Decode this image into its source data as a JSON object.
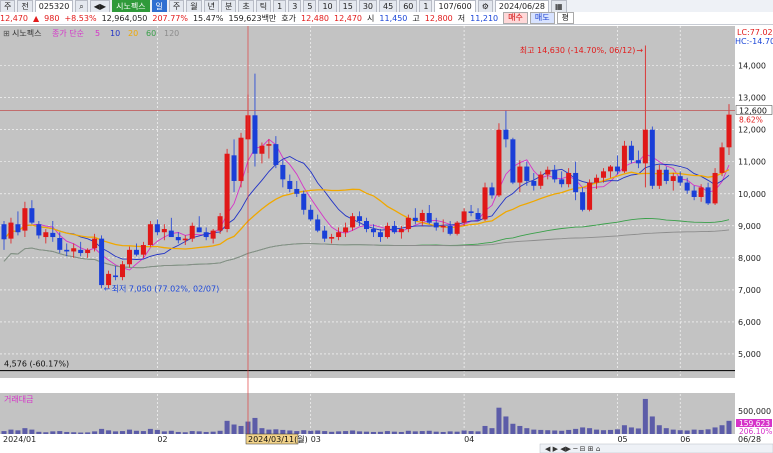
{
  "toolbar": {
    "period_select": "주",
    "type_select": "전",
    "code": "025320",
    "name": "시노펙스",
    "period_buttons": [
      "일",
      "주",
      "월",
      "년",
      "분",
      "초",
      "틱"
    ],
    "interval_buttons": [
      "1",
      "3",
      "5",
      "10",
      "15",
      "30",
      "45",
      "60",
      "1"
    ],
    "range": "107/600",
    "date": "2024/06/28"
  },
  "quote": {
    "price": "12,470",
    "change": "980",
    "change_pct": "+8.53%",
    "volume": "12,964,050",
    "volume_ratio": "207.77%",
    "turnover": "15.47%",
    "value": "159,623백만",
    "ask_label": "호가",
    "ask": "12,480",
    "bid": "12,470",
    "open_label": "시",
    "open": "11,450",
    "high_label": "고",
    "high": "12,800",
    "low_label": "저",
    "low": "11,210",
    "buy_label": "매수",
    "sell_label": "매도",
    "eval_label": "평"
  },
  "legend": {
    "name": "시노펙스",
    "ma_label": "종가 단순",
    "ma_periods": [
      "5",
      "10",
      "20",
      "60",
      "120"
    ],
    "ma_colors": [
      "#d633c9",
      "#2233c6",
      "#f0a800",
      "#3aa04a",
      "#8c8c8c"
    ]
  },
  "annotations": {
    "lc": "LC:77.02",
    "hc": "HC:-14.70",
    "high": "최고 14,630 (-14.70%, 06/12)",
    "low": "최저 7,050 (77.02%, 02/07)",
    "baseline": "4,576 (-60.17%)",
    "crosshair_date": "2024/03/11(월)",
    "current_price": "12,600",
    "current_pct": "8.62%",
    "current_vol": "159,623",
    "current_vol_pct": "206.10%",
    "volume_title": "거래대금"
  },
  "chart_data": {
    "type": "candlestick",
    "price_axis": {
      "ticks": [
        5000,
        6000,
        7000,
        8000,
        9000,
        10000,
        11000,
        12000,
        13000,
        14000
      ]
    },
    "volume_axis": {
      "tick_label": "500,000",
      "tick": 500000
    },
    "x_labels": [
      "2024/01",
      "02",
      "03",
      "04",
      "05",
      "06",
      "06/28"
    ],
    "candles": [
      [
        9050,
        9150,
        8250,
        8580
      ],
      [
        8600,
        9250,
        8450,
        9100
      ],
      [
        9050,
        9450,
        8700,
        8800
      ],
      [
        8850,
        9750,
        8650,
        9550
      ],
      [
        9550,
        9800,
        9050,
        9100
      ],
      [
        9050,
        9150,
        8600,
        8700
      ],
      [
        8650,
        8900,
        8450,
        8800
      ],
      [
        8780,
        9150,
        8500,
        8650
      ],
      [
        8620,
        8800,
        8150,
        8250
      ],
      [
        8250,
        8450,
        8050,
        8200
      ],
      [
        8200,
        8450,
        8000,
        8300
      ],
      [
        8250,
        8500,
        8050,
        8150
      ],
      [
        8150,
        8300,
        8000,
        8250
      ],
      [
        8300,
        8750,
        8200,
        8600
      ],
      [
        8600,
        8700,
        7050,
        7150
      ],
      [
        7150,
        7600,
        7050,
        7500
      ],
      [
        7450,
        7750,
        7300,
        7400
      ],
      [
        7400,
        7900,
        7300,
        7800
      ],
      [
        7800,
        8350,
        7700,
        8250
      ],
      [
        8250,
        8450,
        8050,
        8100
      ],
      [
        8100,
        8500,
        8000,
        8400
      ],
      [
        8400,
        9150,
        8350,
        9050
      ],
      [
        9050,
        9200,
        8700,
        8800
      ],
      [
        8800,
        9050,
        8550,
        8900
      ],
      [
        8850,
        9250,
        8750,
        8650
      ],
      [
        8650,
        8800,
        8450,
        8550
      ],
      [
        8550,
        8700,
        8400,
        8600
      ],
      [
        8600,
        9100,
        8500,
        9000
      ],
      [
        8950,
        9300,
        8800,
        8800
      ],
      [
        8800,
        8950,
        8550,
        8650
      ],
      [
        8600,
        8900,
        8450,
        8850
      ],
      [
        8850,
        9400,
        8750,
        9300
      ],
      [
        8900,
        11400,
        8800,
        11250
      ],
      [
        11200,
        11700,
        10050,
        10400
      ],
      [
        10400,
        11900,
        10200,
        11750
      ],
      [
        11700,
        13100,
        10650,
        12450
      ],
      [
        12450,
        13750,
        10850,
        11250
      ],
      [
        11250,
        11600,
        10950,
        11500
      ],
      [
        11500,
        11700,
        11100,
        11550
      ],
      [
        11550,
        11800,
        10800,
        10900
      ],
      [
        10900,
        11050,
        10200,
        10450
      ],
      [
        10400,
        10600,
        10050,
        10150
      ],
      [
        10150,
        10400,
        9900,
        10000
      ],
      [
        10000,
        10100,
        9350,
        9500
      ],
      [
        9500,
        9650,
        9150,
        9200
      ],
      [
        9200,
        9350,
        8800,
        8850
      ],
      [
        8850,
        9000,
        8500,
        8600
      ],
      [
        8600,
        8750,
        8450,
        8650
      ],
      [
        8650,
        8950,
        8550,
        8800
      ],
      [
        8800,
        9100,
        8650,
        8950
      ],
      [
        8950,
        9400,
        8850,
        9300
      ],
      [
        9300,
        9450,
        9000,
        9150
      ],
      [
        9150,
        9250,
        8800,
        8900
      ],
      [
        8900,
        9050,
        8650,
        8800
      ],
      [
        8800,
        8900,
        8500,
        8650
      ],
      [
        8650,
        9100,
        8600,
        9000
      ],
      [
        9000,
        9150,
        8750,
        8800
      ],
      [
        8800,
        9000,
        8600,
        8900
      ],
      [
        8900,
        9350,
        8800,
        9250
      ],
      [
        9250,
        9550,
        9050,
        9150
      ],
      [
        9150,
        9500,
        9000,
        9400
      ],
      [
        9400,
        9650,
        9050,
        9100
      ],
      [
        9100,
        9250,
        8850,
        8950
      ],
      [
        8950,
        9200,
        8800,
        9000
      ],
      [
        9000,
        9150,
        8700,
        8750
      ],
      [
        8750,
        9150,
        8700,
        9100
      ],
      [
        9100,
        9550,
        9000,
        9450
      ],
      [
        9450,
        9650,
        9300,
        9400
      ],
      [
        9400,
        9550,
        9150,
        9200
      ],
      [
        9200,
        10350,
        9150,
        10200
      ],
      [
        10200,
        10350,
        9850,
        9950
      ],
      [
        9950,
        12200,
        9900,
        12000
      ],
      [
        12000,
        12600,
        11450,
        11700
      ],
      [
        11700,
        11750,
        10300,
        10350
      ],
      [
        10350,
        11050,
        10050,
        10850
      ],
      [
        10850,
        11000,
        10250,
        10400
      ],
      [
        10400,
        10650,
        10100,
        10250
      ],
      [
        10250,
        10700,
        10150,
        10600
      ],
      [
        10600,
        10850,
        10450,
        10750
      ],
      [
        10750,
        10900,
        10350,
        10450
      ],
      [
        10450,
        10700,
        10200,
        10300
      ],
      [
        10300,
        10800,
        10200,
        10650
      ],
      [
        10650,
        11000,
        9800,
        10050
      ],
      [
        10050,
        10200,
        9450,
        9500
      ],
      [
        9500,
        10450,
        9450,
        10350
      ],
      [
        10350,
        10600,
        10150,
        10500
      ],
      [
        10500,
        10800,
        10350,
        10700
      ],
      [
        10700,
        10900,
        10500,
        10850
      ],
      [
        10850,
        11200,
        10600,
        10700
      ],
      [
        10700,
        11650,
        10650,
        11500
      ],
      [
        11500,
        11650,
        10950,
        11050
      ],
      [
        11050,
        11350,
        10800,
        10950
      ],
      [
        10950,
        14630,
        10200,
        12000
      ],
      [
        12000,
        12100,
        10150,
        10250
      ],
      [
        10250,
        10900,
        10150,
        10750
      ],
      [
        10750,
        10850,
        10300,
        10400
      ],
      [
        10400,
        10650,
        10100,
        10550
      ],
      [
        10550,
        10700,
        10250,
        10350
      ],
      [
        10350,
        10500,
        10000,
        10100
      ],
      [
        10100,
        10250,
        9800,
        9900
      ],
      [
        9900,
        10300,
        9750,
        10200
      ],
      [
        10200,
        10350,
        9650,
        9700
      ],
      [
        9700,
        10800,
        9650,
        10650
      ],
      [
        10650,
        11600,
        10550,
        11450
      ],
      [
        11450,
        12800,
        11210,
        12470
      ]
    ],
    "volume": [
      20,
      30,
      25,
      40,
      30,
      15,
      12,
      18,
      20,
      14,
      12,
      10,
      11,
      18,
      35,
      25,
      18,
      20,
      30,
      22,
      20,
      35,
      28,
      18,
      22,
      14,
      12,
      20,
      18,
      14,
      16,
      22,
      90,
      65,
      55,
      85,
      110,
      40,
      30,
      32,
      28,
      24,
      20,
      26,
      22,
      24,
      20,
      15,
      18,
      20,
      24,
      18,
      16,
      14,
      15,
      20,
      16,
      14,
      22,
      18,
      20,
      22,
      16,
      14,
      18,
      16,
      24,
      20,
      18,
      55,
      40,
      180,
      120,
      70,
      55,
      40,
      30,
      28,
      26,
      24,
      22,
      28,
      35,
      45,
      40,
      30,
      26,
      28,
      32,
      60,
      45,
      38,
      240,
      120,
      60,
      40,
      30,
      26,
      24,
      30,
      28,
      32,
      45,
      60,
      90
    ]
  }
}
